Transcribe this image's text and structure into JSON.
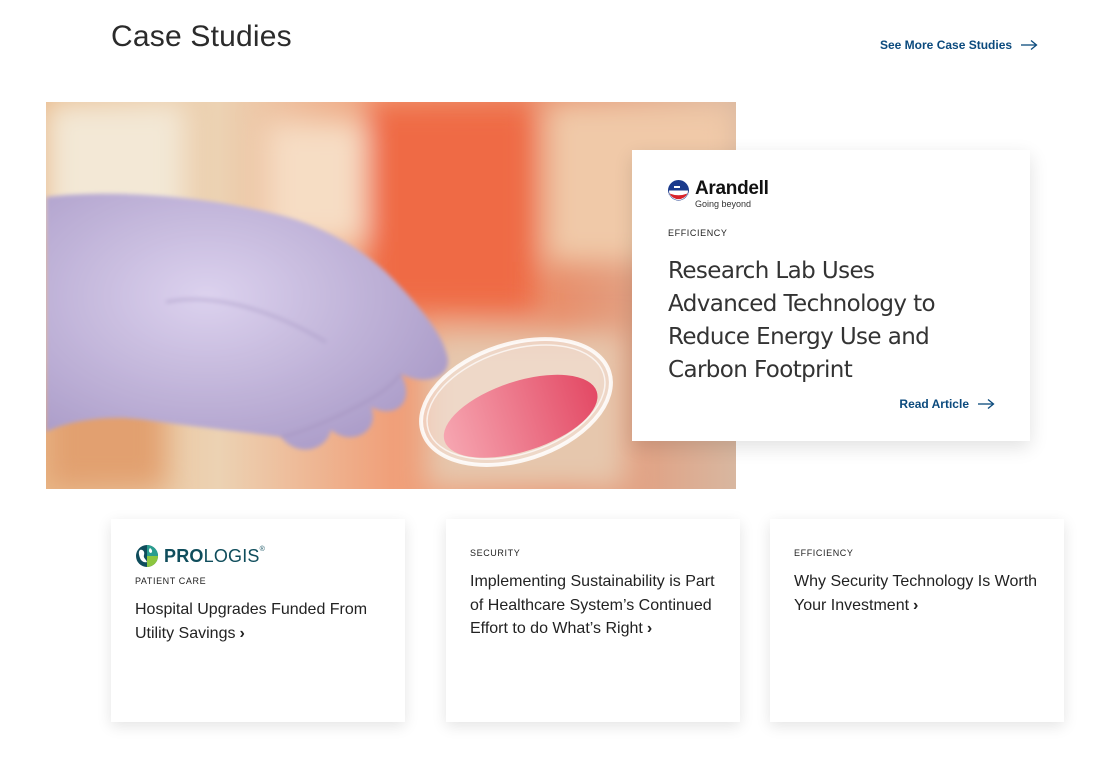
{
  "header": {
    "title": "Case Studies",
    "see_more_label": "See More Case Studies"
  },
  "featured": {
    "brand_name": "Arandell",
    "brand_tagline": "Going beyond",
    "category": "EFFICIENCY",
    "title": "Research Lab Uses Advanced Technology to Reduce Energy Use and Carbon Footprint",
    "cta_label": "Read Article"
  },
  "cards": [
    {
      "brand_prefix": "PRO",
      "brand_suffix": "LOGIS",
      "brand_mark": "®",
      "category": "PATIENT CARE",
      "title": "Hospital Upgrades Funded From Utility Savings",
      "chevron": "›"
    },
    {
      "category": "SECURITY",
      "title": "Implementing Sustainability is Part of Healthcare System’s Continued Effort to do What’s Right",
      "chevron": "›"
    },
    {
      "category": "EFFICIENCY",
      "title": "Why Security Technology Is Worth Your Investment",
      "chevron": "›"
    }
  ],
  "colors": {
    "link": "#0b4a7d",
    "text": "#222222",
    "glove": "#c9bde0",
    "dish_sample": "#e8506a"
  },
  "icons": {
    "arrow": "arrow-right-icon",
    "chevron": "chevron-right-icon"
  }
}
